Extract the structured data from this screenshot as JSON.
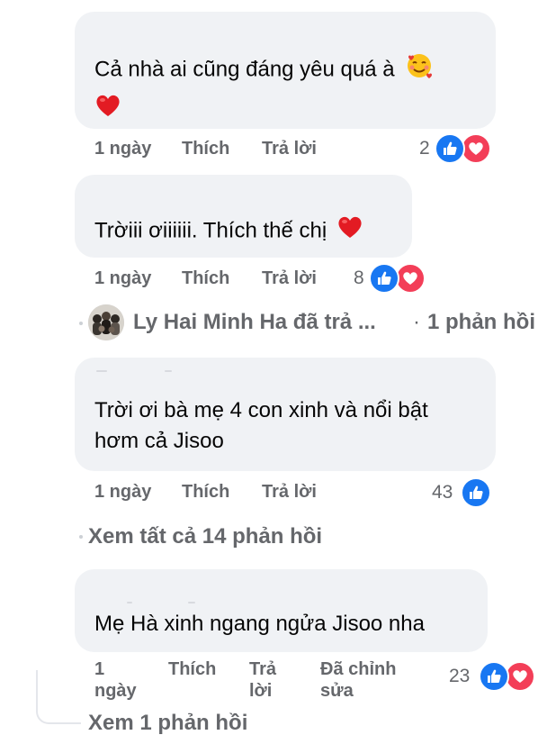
{
  "comments": [
    {
      "text": "Cả nhà ai cũng đáng yêu quá à",
      "time": "1 ngày",
      "like_label": "Thích",
      "reply_label": "Trả lời",
      "reaction_count": "2",
      "reactions": [
        "like-icon",
        "love-icon"
      ],
      "emojis": [
        "smiling-face-with-hearts-icon",
        "red-heart-icon"
      ]
    },
    {
      "text": "Trờiii ơiiiiii. Thích thế chị",
      "time": "1 ngày",
      "like_label": "Thích",
      "reply_label": "Trả lời",
      "reaction_count": "8",
      "reactions": [
        "like-icon",
        "love-icon"
      ],
      "emojis": [
        "red-heart-icon"
      ]
    },
    {
      "text_line1": "Trời ơi bà mẹ 4 con xinh và nổi bật",
      "text_line2": "hơm cả Jisoo",
      "time": "1 ngày",
      "like_label": "Thích",
      "reply_label": "Trả lời",
      "reaction_count": "43",
      "reactions": [
        "like-icon"
      ]
    },
    {
      "text": "Mẹ Hà xinh ngang ngửa Jisoo nha",
      "time_line1": "1",
      "time_line2": "ngày",
      "like_label": "Thích",
      "reply_label_line1": "Trả",
      "reply_label_line2": "lời",
      "edited_line1": "Đã chỉnh",
      "edited_line2": "sửa",
      "reaction_count": "23",
      "reactions": [
        "like-icon",
        "love-icon"
      ]
    }
  ],
  "reply_summary": {
    "author_text": "Ly Hai Minh Ha đã trả ...",
    "separator": "·",
    "count_text": "1 phản hồi"
  },
  "view_all_replies": "Xem tất cả 14 phản hồi",
  "view_one_reply": "Xem 1 phản hồi",
  "colors": {
    "bubble": "#f0f2f5",
    "meta_text": "#65676b",
    "like_blue": "#1877f2",
    "love_red": "#f33e58"
  }
}
